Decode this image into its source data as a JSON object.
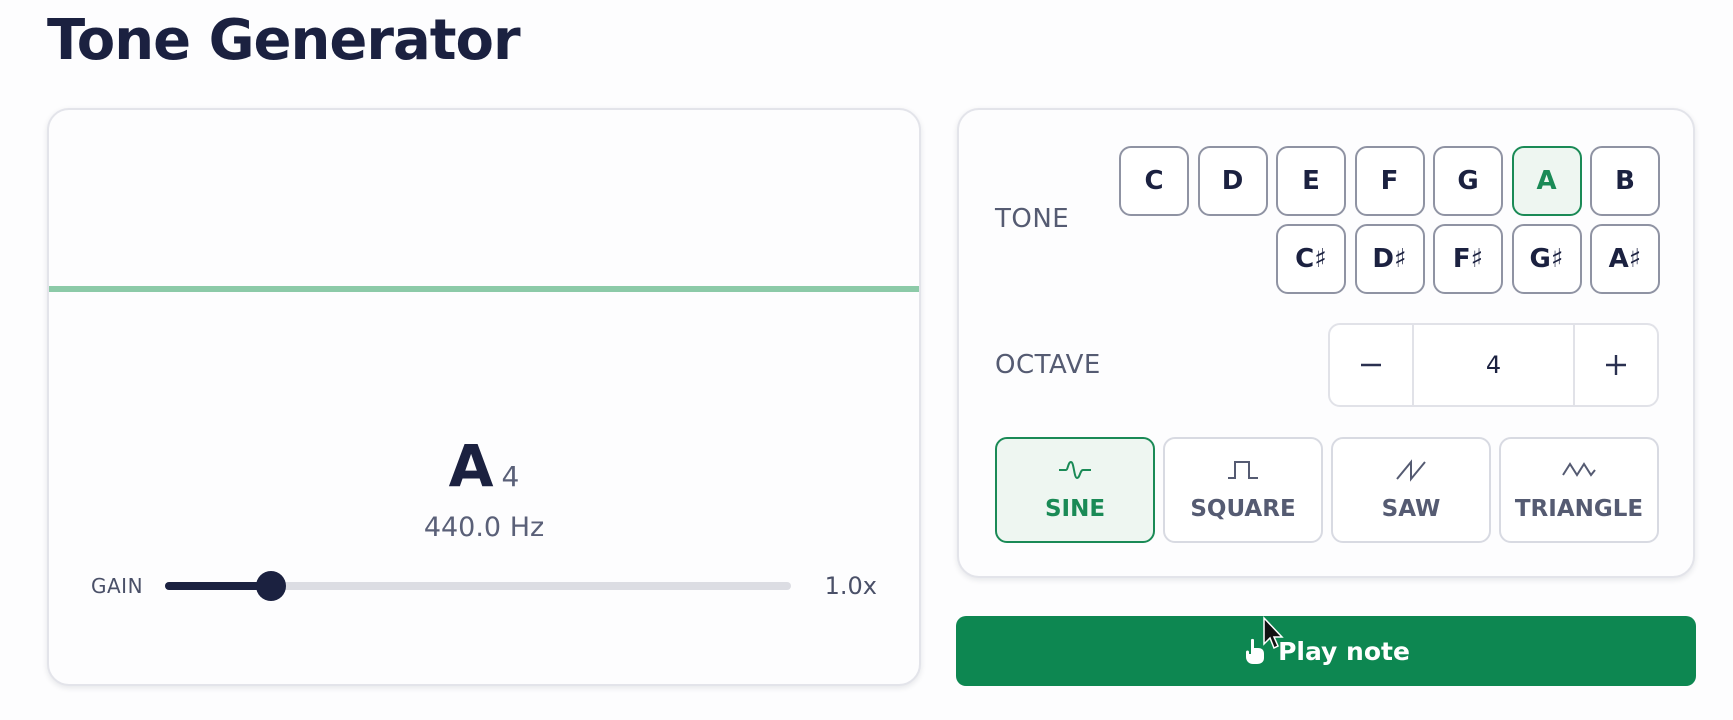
{
  "page": {
    "title": "Tone Generator"
  },
  "visualizer": {
    "note": "A",
    "octave": "4",
    "frequency": "440.0 Hz",
    "wave_color": "#8ccaa8",
    "gain": {
      "label": "GAIN",
      "value": "1.0x",
      "level_fraction": 0.17
    }
  },
  "controls": {
    "tone_label": "TONE",
    "tones_natural": [
      "C",
      "D",
      "E",
      "F",
      "G",
      "A",
      "B"
    ],
    "tones_sharp": [
      "C♯",
      "D♯",
      "F♯",
      "G♯",
      "A♯"
    ],
    "selected_tone": "A",
    "octave_label": "OCTAVE",
    "octave_value": "4",
    "octave_decrement_icon": "minus-icon",
    "octave_increment_icon": "plus-icon",
    "waveforms": [
      {
        "label": "SINE",
        "icon": "sine-wave-icon",
        "selected": true
      },
      {
        "label": "SQUARE",
        "icon": "square-wave-icon",
        "selected": false
      },
      {
        "label": "SAW",
        "icon": "saw-wave-icon",
        "selected": false
      },
      {
        "label": "TRIANGLE",
        "icon": "triangle-wave-icon",
        "selected": false
      }
    ],
    "accent_color": "#1a8a56"
  },
  "play": {
    "label": "Play note",
    "color": "#0d8751"
  }
}
